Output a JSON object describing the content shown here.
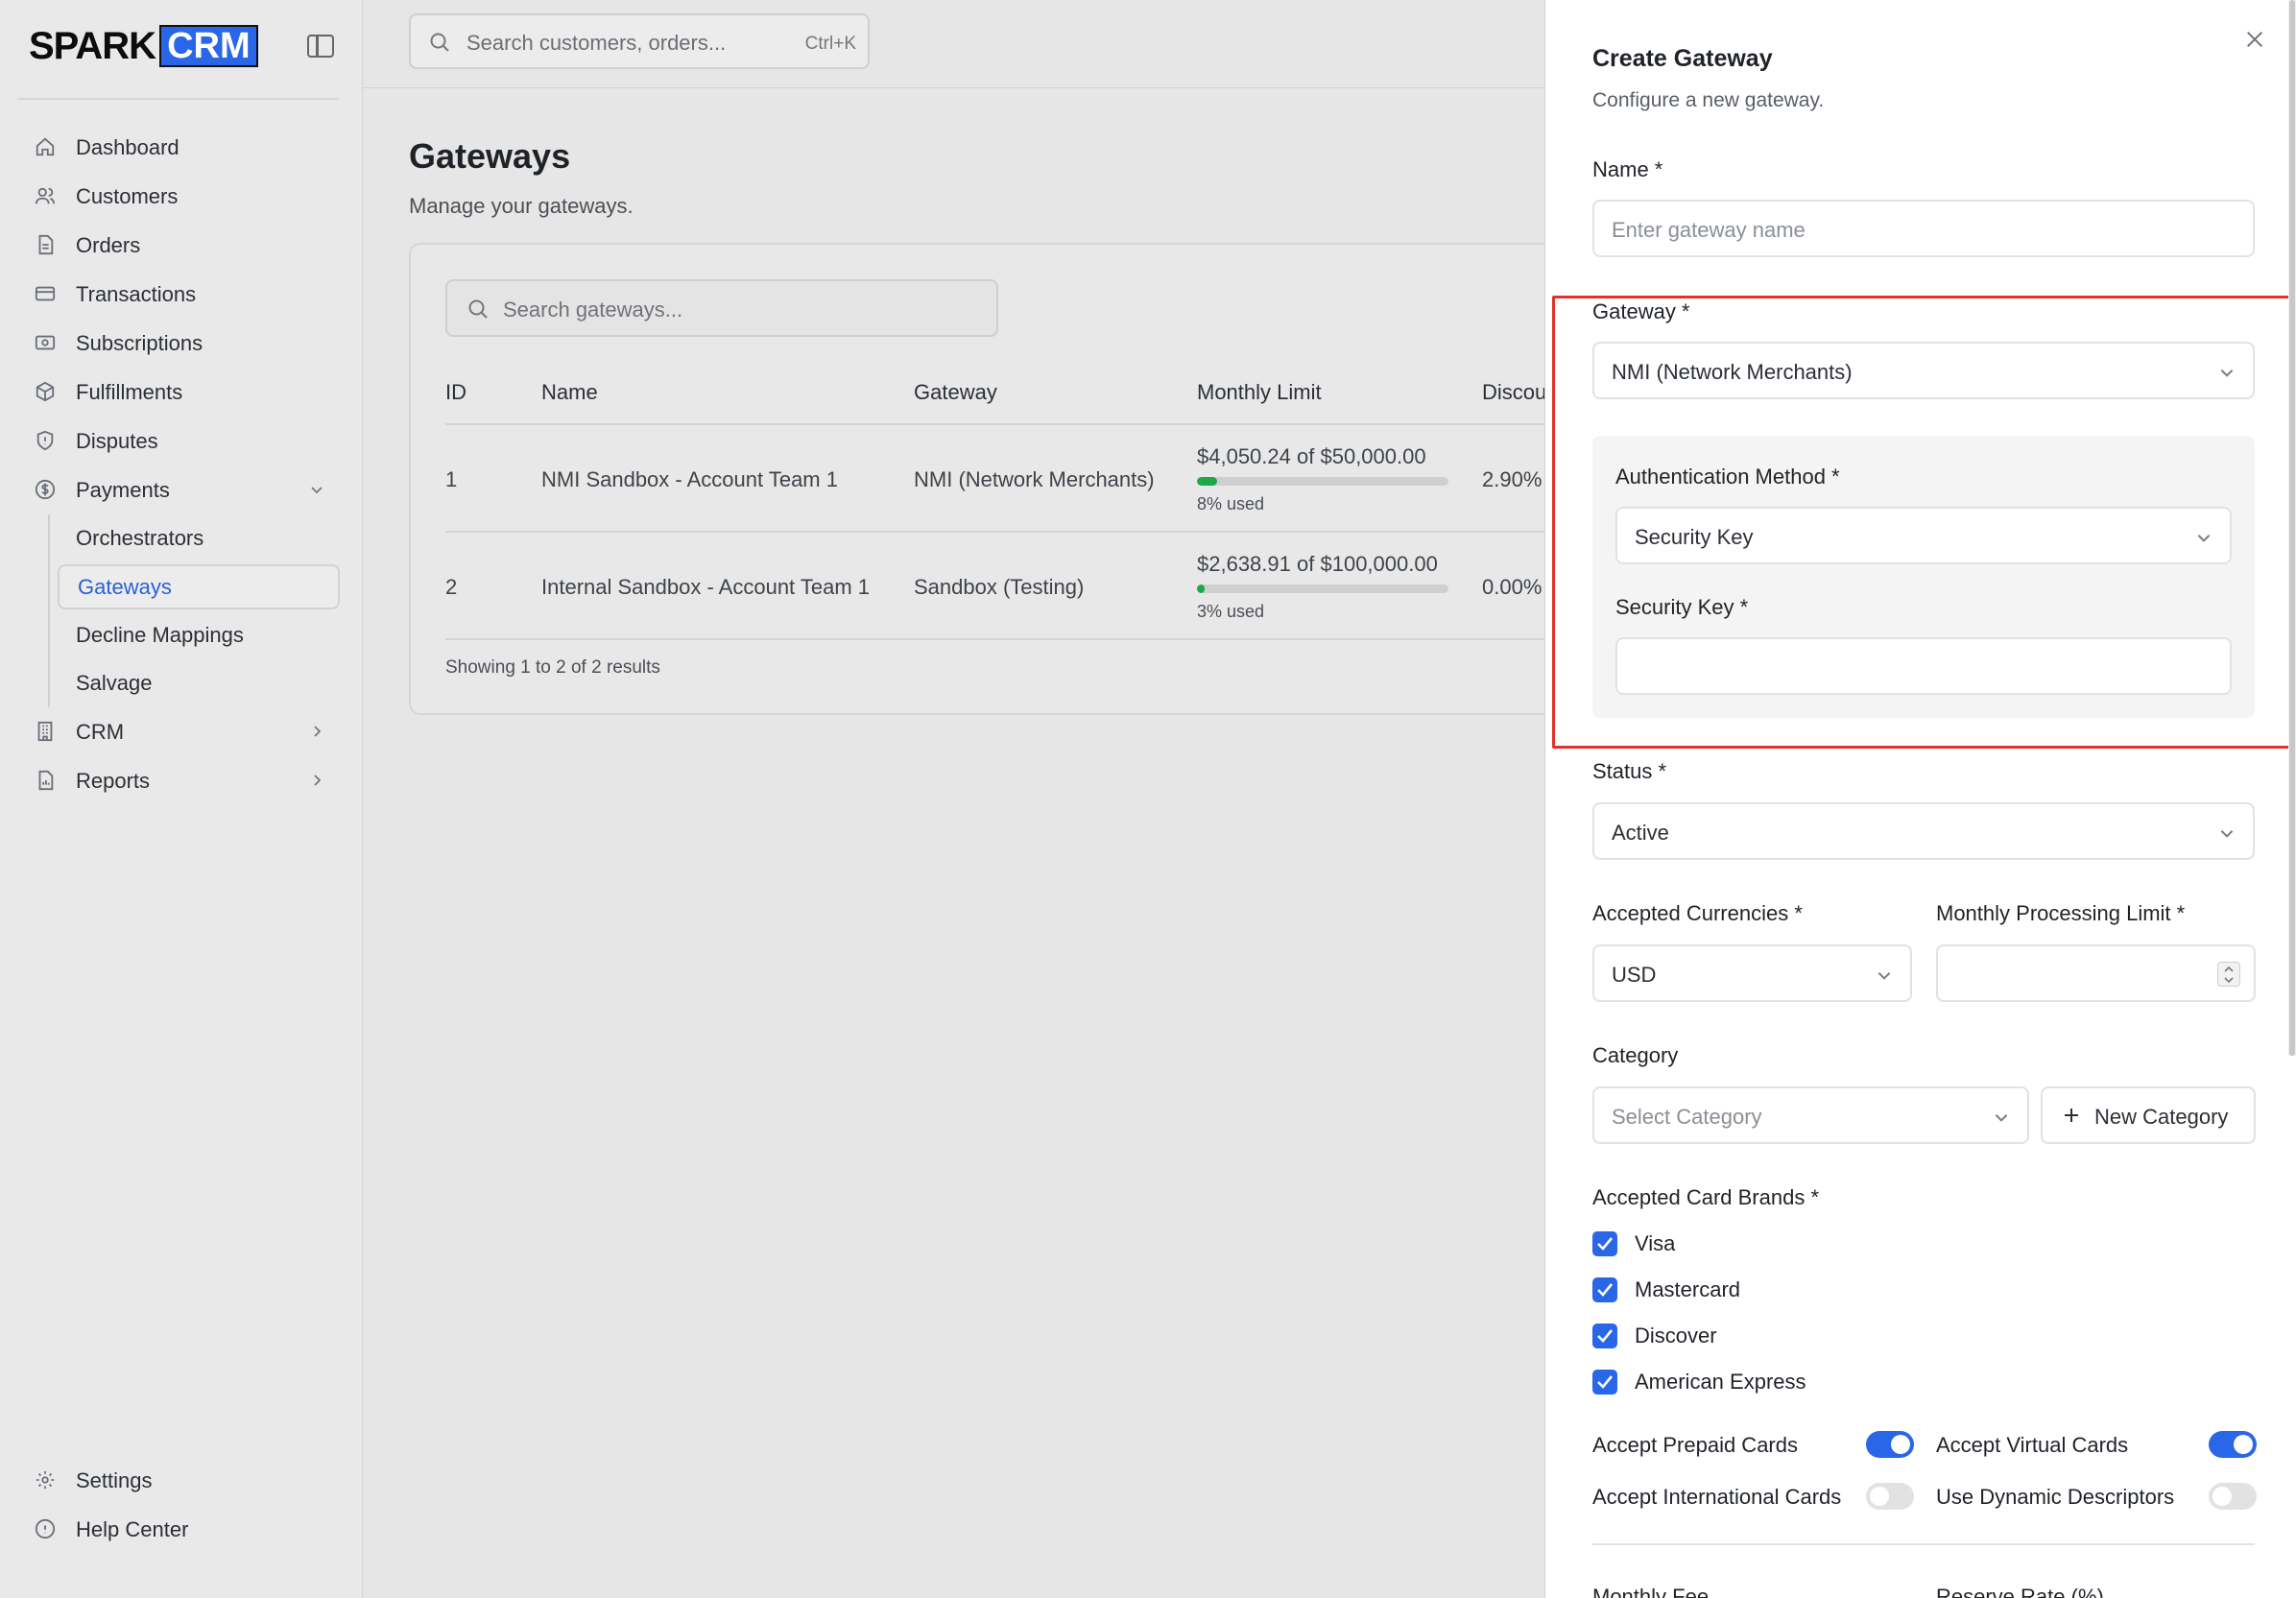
{
  "brand": {
    "spark": "SPARK",
    "crm": "CRM"
  },
  "search": {
    "placeholder": "Search customers, orders...",
    "shortcut": "Ctrl+K"
  },
  "sidebar": {
    "items": [
      {
        "label": "Dashboard",
        "icon": "home-icon"
      },
      {
        "label": "Customers",
        "icon": "users-icon"
      },
      {
        "label": "Orders",
        "icon": "file-icon"
      },
      {
        "label": "Transactions",
        "icon": "credit-card-icon"
      },
      {
        "label": "Subscriptions",
        "icon": "subscription-icon"
      },
      {
        "label": "Fulfillments",
        "icon": "box-icon"
      },
      {
        "label": "Disputes",
        "icon": "shield-icon"
      },
      {
        "label": "Payments",
        "icon": "dollar-icon"
      }
    ],
    "payments_sub": [
      "Orchestrators",
      "Gateways",
      "Decline Mappings",
      "Salvage"
    ],
    "more": [
      {
        "label": "CRM",
        "icon": "building-icon"
      },
      {
        "label": "Reports",
        "icon": "report-icon"
      }
    ],
    "bottom": [
      {
        "label": "Settings",
        "icon": "gear-icon"
      },
      {
        "label": "Help Center",
        "icon": "help-icon"
      }
    ]
  },
  "main": {
    "title": "Gateways",
    "subtitle": "Manage your gateways.",
    "table_search_placeholder": "Search gateways...",
    "columns": [
      "ID",
      "Name",
      "Gateway",
      "Monthly Limit",
      "Discou"
    ],
    "rows": [
      {
        "id": "1",
        "name": "NMI Sandbox - Account Team 1",
        "gateway": "NMI (Network Merchants)",
        "used_amount": "$4,050.24",
        "of": "of",
        "limit": "$50,000.00",
        "used_pct": 8,
        "used_label": "8% used",
        "discount": "2.90%"
      },
      {
        "id": "2",
        "name": "Internal Sandbox - Account Team 1",
        "gateway": "Sandbox (Testing)",
        "used_amount": "$2,638.91",
        "of": "of",
        "limit": "$100,000.00",
        "used_pct": 3,
        "used_label": "3% used",
        "discount": "0.00%"
      }
    ],
    "showing": "Showing 1 to 2 of 2 results"
  },
  "drawer": {
    "title": "Create Gateway",
    "subtitle": "Configure a new gateway.",
    "name_label": "Name *",
    "name_placeholder": "Enter gateway name",
    "gateway_label": "Gateway *",
    "gateway_value": "NMI (Network Merchants)",
    "auth_label": "Authentication Method *",
    "auth_value": "Security Key",
    "key_label": "Security Key *",
    "key_value": "",
    "status_label": "Status *",
    "status_value": "Active",
    "currencies_label": "Accepted Currencies *",
    "currencies_value": "USD",
    "limit_label": "Monthly Processing Limit *",
    "limit_value": "",
    "category_label": "Category",
    "category_placeholder": "Select Category",
    "new_category": "New Category",
    "brands_label": "Accepted Card Brands *",
    "brands": [
      "Visa",
      "Mastercard",
      "Discover",
      "American Express"
    ],
    "toggles": [
      {
        "label": "Accept Prepaid Cards",
        "on": true
      },
      {
        "label": "Accept Virtual Cards",
        "on": true
      },
      {
        "label": "Accept International Cards",
        "on": false
      },
      {
        "label": "Use Dynamic Descriptors",
        "on": false
      }
    ],
    "cut_labels": [
      "Monthly Fee",
      "Reserve Rate (%)"
    ]
  },
  "colors": {
    "accent": "#2a66e8",
    "progress": "#1ea84a",
    "highlight": "#e0322d"
  }
}
